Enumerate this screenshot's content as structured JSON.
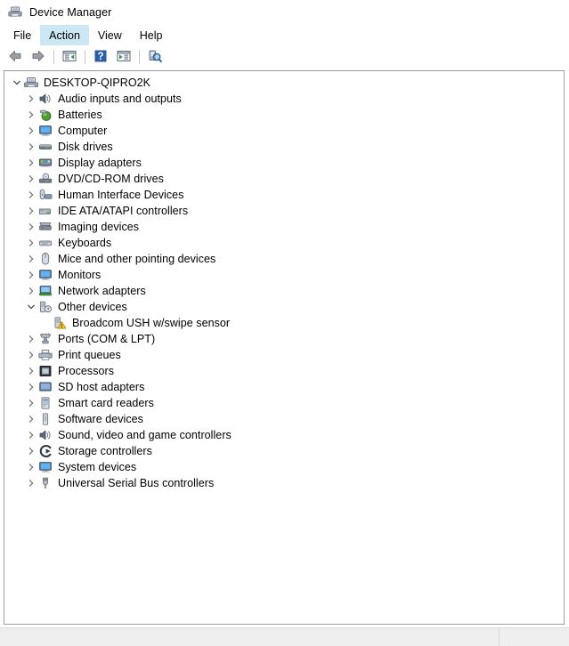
{
  "window": {
    "title": "Device Manager",
    "icon": "device-manager-icon"
  },
  "menubar": {
    "items": [
      {
        "label": "File",
        "hovered": false
      },
      {
        "label": "Action",
        "hovered": true
      },
      {
        "label": "View",
        "hovered": false
      },
      {
        "label": "Help",
        "hovered": false
      }
    ]
  },
  "toolbar": {
    "buttons": [
      {
        "name": "back-button",
        "icon": "back-arrow-icon",
        "tip": "Back"
      },
      {
        "name": "forward-button",
        "icon": "forward-arrow-icon",
        "tip": "Forward"
      },
      {
        "name": "show-hide-console-tree-button",
        "icon": "console-tree-icon",
        "tip": "Show/Hide Console Tree"
      },
      {
        "name": "help-button",
        "icon": "help-question-icon",
        "tip": "Help"
      },
      {
        "name": "properties-button",
        "icon": "properties-icon",
        "tip": "Properties"
      },
      {
        "name": "scan-for-hardware-changes-button",
        "icon": "scan-hardware-icon",
        "tip": "Scan for hardware changes"
      }
    ]
  },
  "tree": {
    "root": {
      "label": "DESKTOP-QIPRO2K",
      "icon": "computer-root-icon",
      "expanded": true,
      "level": 0
    },
    "nodes": [
      {
        "label": "Audio inputs and outputs",
        "icon": "speaker-icon",
        "expanded": false,
        "level": 1
      },
      {
        "label": "Batteries",
        "icon": "battery-icon",
        "expanded": false,
        "level": 1
      },
      {
        "label": "Computer",
        "icon": "monitor-icon",
        "expanded": false,
        "level": 1
      },
      {
        "label": "Disk drives",
        "icon": "disk-drive-icon",
        "expanded": false,
        "level": 1
      },
      {
        "label": "Display adapters",
        "icon": "display-adapter-icon",
        "expanded": false,
        "level": 1
      },
      {
        "label": "DVD/CD-ROM drives",
        "icon": "dvd-drive-icon",
        "expanded": false,
        "level": 1
      },
      {
        "label": "Human Interface Devices",
        "icon": "hid-icon",
        "expanded": false,
        "level": 1
      },
      {
        "label": "IDE ATA/ATAPI controllers",
        "icon": "ide-controller-icon",
        "expanded": false,
        "level": 1
      },
      {
        "label": "Imaging devices",
        "icon": "imaging-device-icon",
        "expanded": false,
        "level": 1
      },
      {
        "label": "Keyboards",
        "icon": "keyboard-icon",
        "expanded": false,
        "level": 1
      },
      {
        "label": "Mice and other pointing devices",
        "icon": "mouse-icon",
        "expanded": false,
        "level": 1
      },
      {
        "label": "Monitors",
        "icon": "monitor-icon",
        "expanded": false,
        "level": 1
      },
      {
        "label": "Network adapters",
        "icon": "network-adapter-icon",
        "expanded": false,
        "level": 1
      },
      {
        "label": "Other devices",
        "icon": "other-device-icon",
        "expanded": true,
        "level": 1
      },
      {
        "label": "Broadcom USH w/swipe sensor",
        "icon": "unknown-device-warning-icon",
        "expanded": null,
        "level": 2
      },
      {
        "label": "Ports (COM & LPT)",
        "icon": "port-icon",
        "expanded": false,
        "level": 1
      },
      {
        "label": "Print queues",
        "icon": "printer-icon",
        "expanded": false,
        "level": 1
      },
      {
        "label": "Processors",
        "icon": "processor-icon",
        "expanded": false,
        "level": 1
      },
      {
        "label": "SD host adapters",
        "icon": "sd-host-adapter-icon",
        "expanded": false,
        "level": 1
      },
      {
        "label": "Smart card readers",
        "icon": "smart-card-reader-icon",
        "expanded": false,
        "level": 1
      },
      {
        "label": "Software devices",
        "icon": "software-device-icon",
        "expanded": false,
        "level": 1
      },
      {
        "label": "Sound, video and game controllers",
        "icon": "speaker-icon",
        "expanded": false,
        "level": 1
      },
      {
        "label": "Storage controllers",
        "icon": "storage-controller-icon",
        "expanded": false,
        "level": 1
      },
      {
        "label": "System devices",
        "icon": "monitor-icon",
        "expanded": false,
        "level": 1
      },
      {
        "label": "Universal Serial Bus controllers",
        "icon": "usb-icon",
        "expanded": false,
        "level": 1
      }
    ]
  },
  "statusbar": {
    "text": ""
  },
  "colors": {
    "menu_hover": "#cce8f4",
    "panel_border": "#a0a0a0",
    "statusbar_bg": "#efefef",
    "warning_yellow": "#ffcc33",
    "accent_blue": "#2a5fa8"
  }
}
